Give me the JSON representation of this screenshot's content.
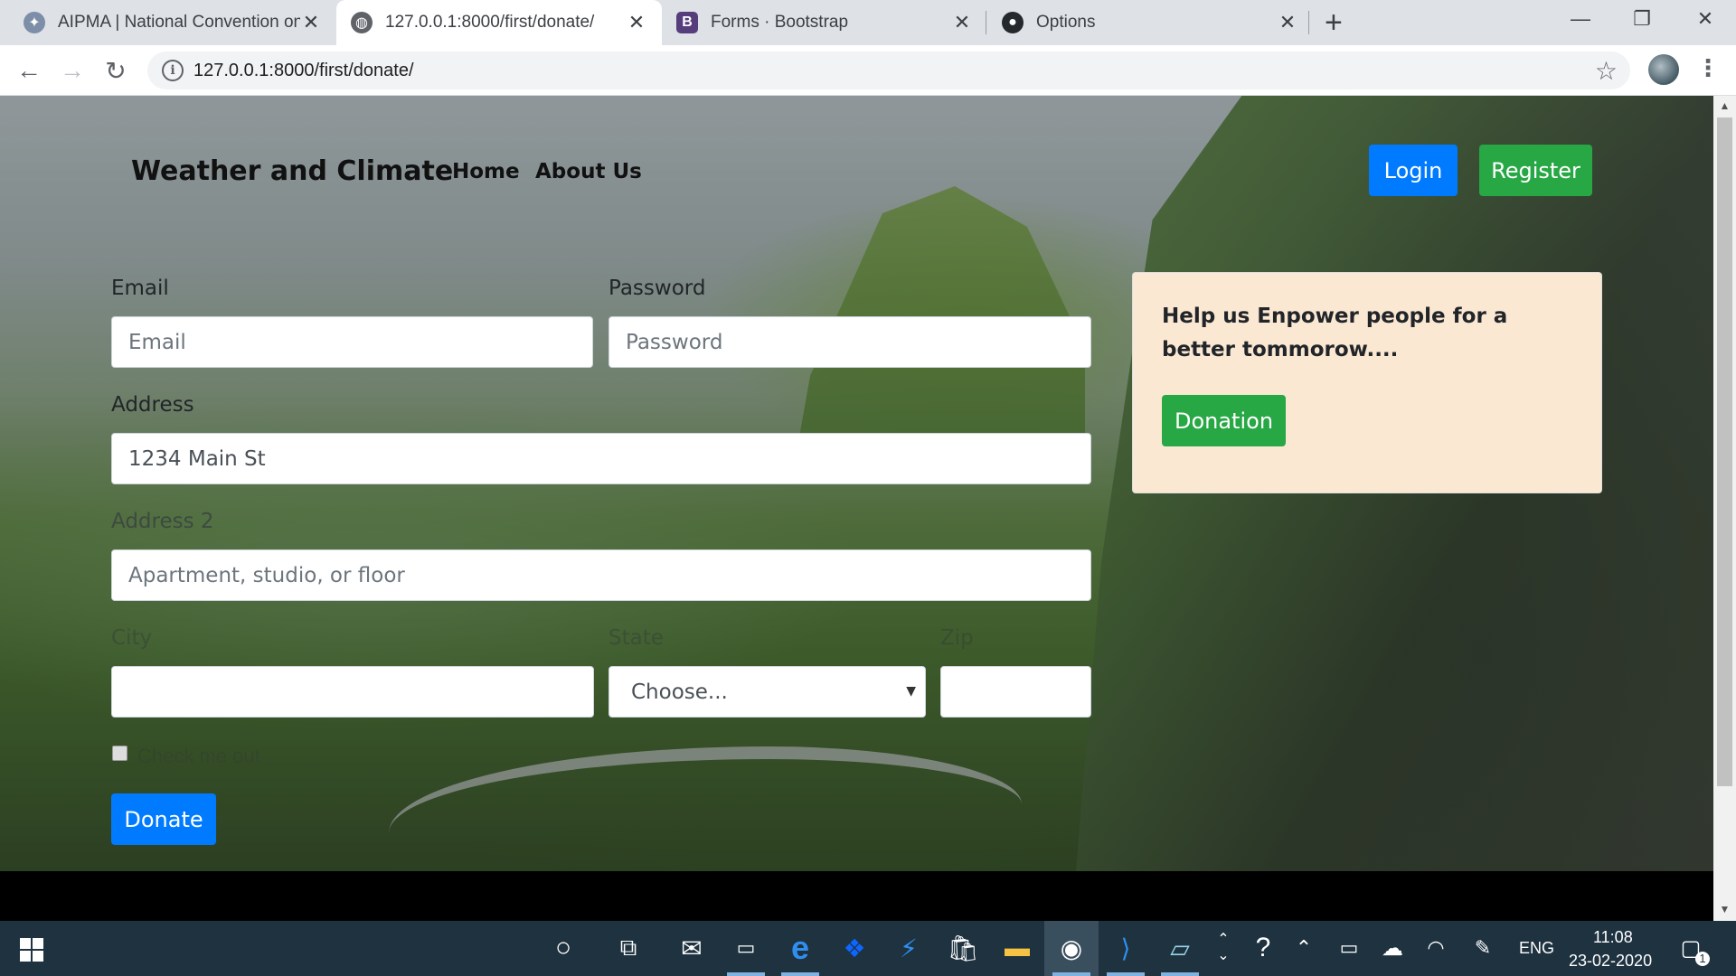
{
  "browser": {
    "tabs": [
      {
        "title": "AIPMA | National Convention on",
        "active": false
      },
      {
        "title": "127.0.0.1:8000/first/donate/",
        "active": true
      },
      {
        "title": "Forms · Bootstrap",
        "active": false
      },
      {
        "title": "Options",
        "active": false
      }
    ],
    "url": "127.0.0.1:8000/first/donate/"
  },
  "site": {
    "brand": "Weather and Climate",
    "nav": [
      "Home",
      "About Us"
    ],
    "login_label": "Login",
    "register_label": "Register"
  },
  "form": {
    "email_label": "Email",
    "email_placeholder": "Email",
    "password_label": "Password",
    "password_placeholder": "Password",
    "address_label": "Address",
    "address_value": "1234 Main St",
    "address2_label": "Address 2",
    "address2_placeholder": "Apartment, studio, or floor",
    "city_label": "City",
    "state_label": "State",
    "state_selected": "Choose...",
    "zip_label": "Zip",
    "checkbox_label": "Check me out",
    "submit_label": "Donate"
  },
  "card": {
    "text": "Help us Enpower people for a better tommorow....",
    "button_label": "Donation"
  },
  "taskbar": {
    "language": "ENG",
    "time": "11:08",
    "date": "23-02-2020",
    "notification_count": "1"
  },
  "colors": {
    "primary": "#007bff",
    "success": "#28a745",
    "card_bg": "#fbe8d2",
    "taskbar": "#1e3240"
  }
}
